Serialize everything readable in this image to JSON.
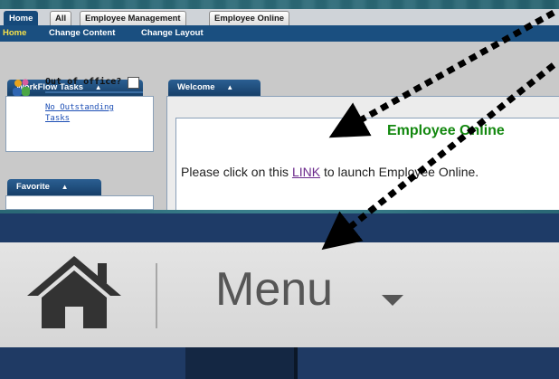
{
  "portal": {
    "tabs": [
      {
        "label": "Home",
        "active": true
      },
      {
        "label": "All",
        "active": false
      },
      {
        "label": "Employee Management",
        "active": false
      },
      {
        "label": "Employee Online",
        "active": false
      }
    ],
    "subnav": [
      {
        "label": "Home",
        "current": true
      },
      {
        "label": "Change Content",
        "current": false
      },
      {
        "label": "Change Layout",
        "current": false
      }
    ],
    "workflow": {
      "title": "WorkFlow Tasks",
      "out_of_office_label": "Out of office?",
      "no_tasks_link": "No Outstanding Tasks"
    },
    "favorite": {
      "title": "Favorite"
    },
    "welcome": {
      "title": "Welcome",
      "heading": "Employee Online",
      "message_before": "Please click on this ",
      "link_text": "LINK",
      "message_after": " to launch Employee Online."
    }
  },
  "zoom_header": {
    "menu_label": "Menu"
  },
  "icons": {
    "home": "home-icon",
    "dropdown": "caret-down-icon",
    "collapse": "caret-up-icon",
    "workflow": "people-icon"
  },
  "colors": {
    "nav_blue": "#1a4f80",
    "welcome_green": "#13880f",
    "link_purple": "#6b2a8c",
    "header_navy": "#1e3b67"
  }
}
